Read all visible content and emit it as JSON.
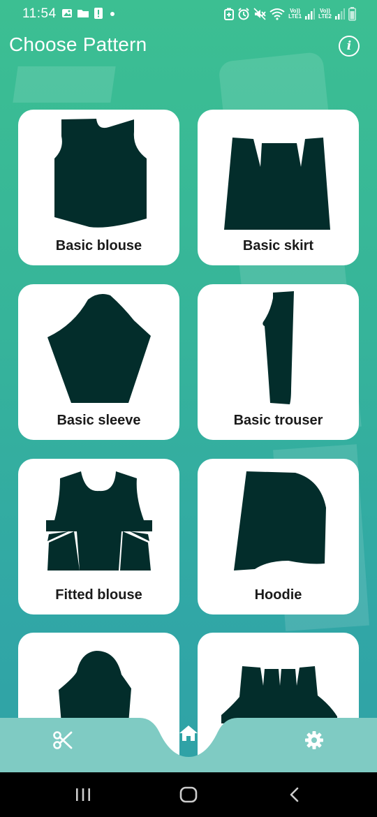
{
  "status_bar": {
    "time": "11:54",
    "left_icons": [
      "gallery-icon",
      "folder-icon",
      "alert-icon",
      "dot-icon"
    ],
    "right_icons": [
      "battery-saver-icon",
      "alarm-icon",
      "mute-icon",
      "wifi-icon",
      "volte1-icon",
      "signal1-icon",
      "volte2-icon",
      "signal2-icon",
      "battery-icon"
    ],
    "sim1": {
      "top": "Vo))",
      "bottom": "LTE1"
    },
    "sim2": {
      "top": "Vo))",
      "bottom": "LTE2"
    }
  },
  "header": {
    "title": "Choose Pattern",
    "info_icon": "info-icon",
    "info_glyph": "i"
  },
  "patterns": [
    {
      "label": "Basic blouse",
      "icon": "blouse-pattern-icon"
    },
    {
      "label": "Basic skirt",
      "icon": "skirt-pattern-icon"
    },
    {
      "label": "Basic sleeve",
      "icon": "sleeve-pattern-icon"
    },
    {
      "label": "Basic trouser",
      "icon": "trouser-pattern-icon"
    },
    {
      "label": "Fitted blouse",
      "icon": "fitted-blouse-pattern-icon"
    },
    {
      "label": "Hoodie",
      "icon": "hoodie-pattern-icon"
    },
    {
      "label": "",
      "icon": "hood-pattern-icon"
    },
    {
      "label": "",
      "icon": "shorts-pattern-icon"
    }
  ],
  "bottom_nav": {
    "items": [
      "scissors-icon",
      "home-icon",
      "settings-icon"
    ],
    "active": "home-icon"
  },
  "system_nav": {
    "items": [
      "recent-apps-icon",
      "home-circle-icon",
      "back-icon"
    ]
  },
  "colors": {
    "accent": "#3cbf92",
    "accent_dark": "#2fa0a6",
    "pattern_fill": "#032d2b",
    "nav_bar": "#7fcbc3",
    "text_dark": "#1a1a1a"
  }
}
